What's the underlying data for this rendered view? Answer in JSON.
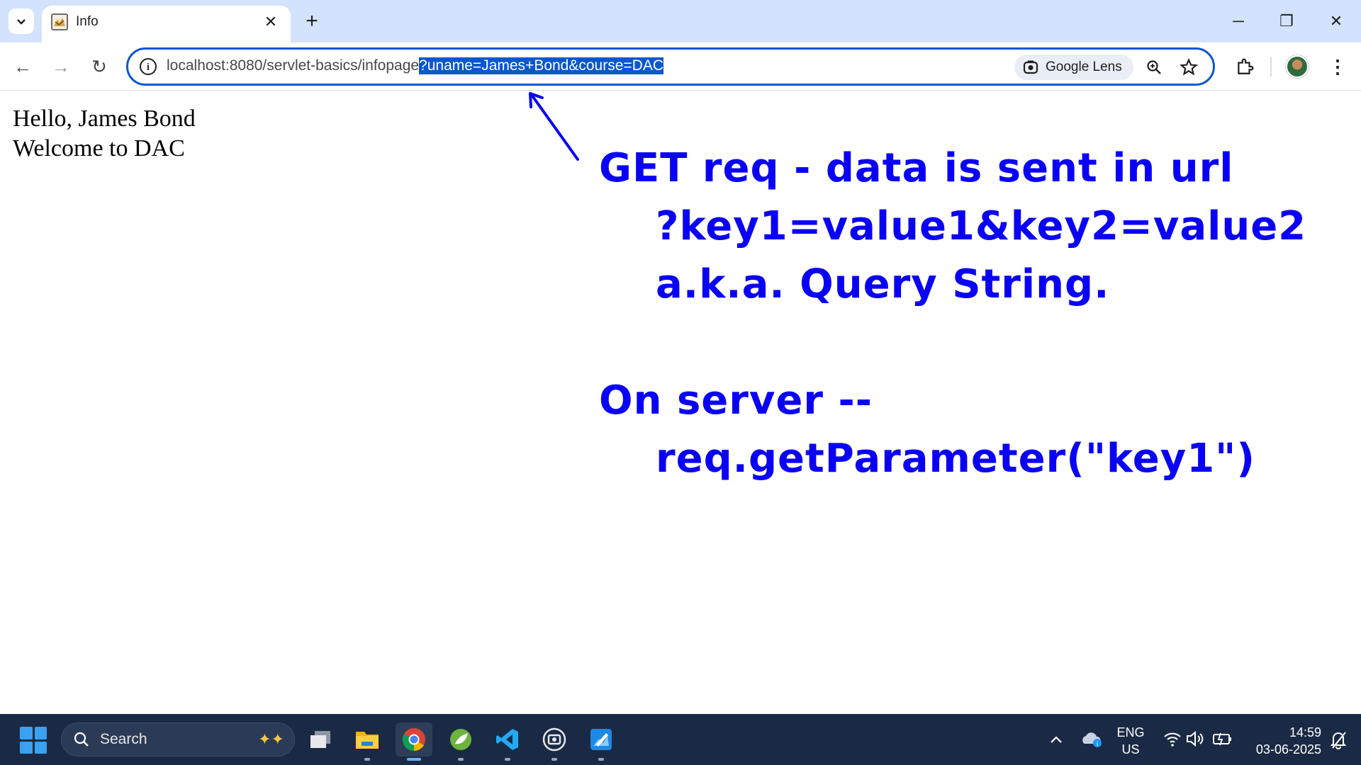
{
  "browser": {
    "tab": {
      "title": "Info",
      "close_glyph": "✕"
    },
    "new_tab_glyph": "+",
    "window_controls": {
      "minimize": "─",
      "restore": "❐",
      "close": "✕"
    },
    "nav": {
      "back": "←",
      "forward": "→",
      "reload": "↻"
    },
    "url": {
      "base": "localhost:8080/servlet-basics/infopage",
      "query_selected": "?uname=James+Bond&course=DAC"
    },
    "lens_label": "Google Lens",
    "menu_glyph": "⋮"
  },
  "page": {
    "line1": "Hello, James Bond",
    "line2": "Welcome to DAC"
  },
  "annotations": {
    "line1": "GET req - data is sent in url",
    "line2": "?key1=value1&key2=value2",
    "line3": "a.k.a. Query String.",
    "line4": "On server --",
    "line5": "req.getParameter(\"key1\")",
    "color": "#0a00f5"
  },
  "taskbar": {
    "search_label": "Search",
    "language": {
      "lang": "ENG",
      "region": "US"
    },
    "clock": {
      "time": "14:59",
      "date": "03-06-2025"
    },
    "apps": [
      "task-view-icon",
      "file-explorer-icon",
      "chrome-icon",
      "spring-tools-icon",
      "vscode-icon",
      "snipping-tool-icon",
      "paint-icon"
    ]
  },
  "colors": {
    "accent": "#0b57d0",
    "tabstrip": "#d3e3fd",
    "taskbar": "#1b2a44"
  }
}
